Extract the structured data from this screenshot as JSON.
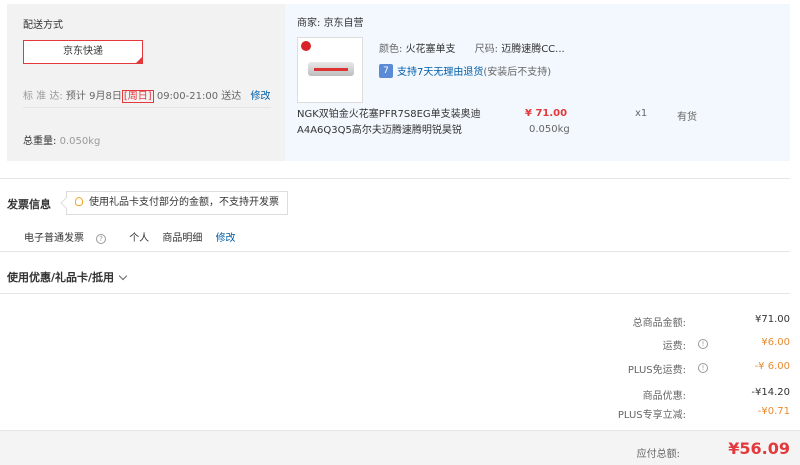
{
  "shipping": {
    "title": "配送方式",
    "method": "京东快递",
    "delivery_label": "标 准 达:",
    "delivery_prefix": "预计 9月8日",
    "delivery_day": "[周日]",
    "delivery_time": "09:00-21:00 送达",
    "edit_label": "修改",
    "weight_label": "总重量:",
    "weight_value": "0.050kg"
  },
  "seller": {
    "label": "商家:",
    "name": "京东自营"
  },
  "product": {
    "color_label": "颜色:",
    "color_value": "火花塞单支",
    "size_label": "尺码:",
    "size_value": "迈腾速腾CC...",
    "promise_icon": "7",
    "promise_text": "支持7天无理由退货",
    "promise_note": "(安装后不支持)",
    "name": "NGK双铂金火花塞PFR7S8EG单支装奥迪A4A6Q3Q5高尔夫迈腾速腾明锐昊锐",
    "price": "¥ 71.00",
    "weight": "0.050kg",
    "quantity": "x1",
    "stock": "有货"
  },
  "invoice": {
    "title": "发票信息",
    "tip": "使用礼品卡支付部分的金额，不支持开发票",
    "type": "电子普通发票",
    "holder": "个人",
    "content": "商品明细",
    "edit_label": "修改"
  },
  "coupon": {
    "title": "使用优惠/礼品卡/抵用"
  },
  "summary": {
    "rows": [
      {
        "label": "总商品金额:",
        "value": "¥71.00"
      },
      {
        "label": "运费:",
        "value": "¥6.00"
      },
      {
        "label": "PLUS免运费:",
        "value": "-¥ 6.00"
      },
      {
        "label": "商品优惠:",
        "value": "-¥14.20"
      },
      {
        "label": "PLUS专享立减:",
        "value": "-¥0.71"
      }
    ],
    "total_label": "应付总额:",
    "total_value": "¥56.09"
  },
  "colors": {
    "accent_red": "#e4393c",
    "link_blue": "#005ea7",
    "discount_orange": "#e88a2e"
  }
}
